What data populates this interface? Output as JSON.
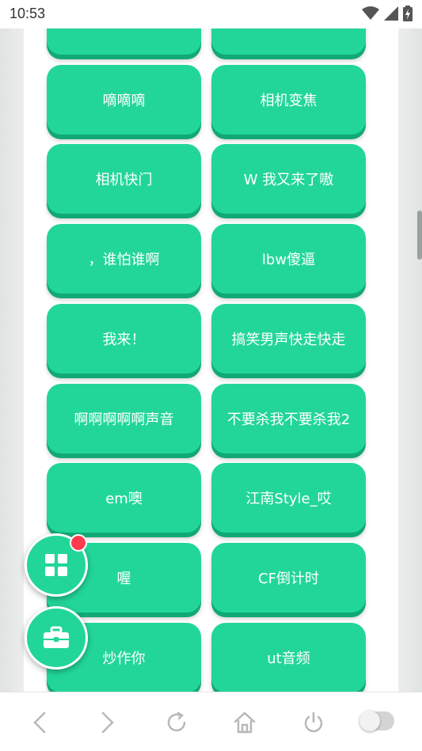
{
  "status_bar": {
    "time": "10:53"
  },
  "sounds": [
    "",
    "",
    "嘀嘀嘀",
    "相机变焦",
    "相机快门",
    "W 我又来了嗷",
    "，谁怕谁啊",
    "lbw傻逼",
    "我来！",
    "搞笑男声快走快走",
    "啊啊啊啊啊声音",
    "不要杀我不要杀我2",
    "em噢",
    "江南Style_哎",
    "喔",
    "CF倒计时",
    "炒作你",
    "ut音频",
    "",
    ""
  ],
  "colors": {
    "button": "#22d69a",
    "button_shadow": "#12a877",
    "badge": "#ff3b4f"
  },
  "icons": {
    "fab_top": "grid-icon",
    "fab_bottom": "toolbox-icon",
    "nav": [
      "back-icon",
      "forward-icon",
      "refresh-icon",
      "home-icon",
      "power-icon"
    ]
  }
}
